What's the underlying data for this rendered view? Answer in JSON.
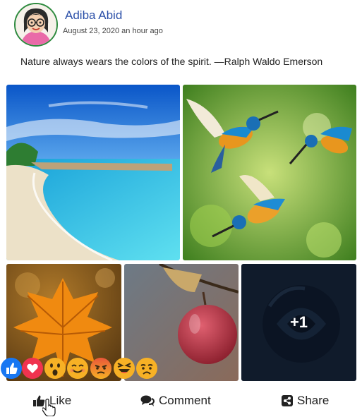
{
  "post": {
    "author": "Adiba Abid",
    "timestamp": "August 23, 2020 an hour ago",
    "text": "Nature always wears the colors of the spirit. —Ralph Waldo Emerson",
    "more_photos_label": "+1"
  },
  "photos": [
    {
      "subject": "tropical-beach"
    },
    {
      "subject": "kingfisher-birds"
    },
    {
      "subject": "autumn-leaf"
    },
    {
      "subject": "apple"
    },
    {
      "subject": "dark-rose"
    }
  ],
  "reactions": [
    "like-icon",
    "love-icon",
    "wow-icon",
    "smile-icon",
    "angry-icon",
    "laugh-icon",
    "sad-icon"
  ],
  "actions": {
    "like_label": "Like",
    "comment_label": "Comment",
    "share_label": "Share"
  },
  "colors": {
    "author_name": "#2a4fa8",
    "avatar_border": "#2d8a3e",
    "like_blue": "#1877f2",
    "love_red": "#f0334f",
    "emoji_yellow": "#f7b125"
  }
}
